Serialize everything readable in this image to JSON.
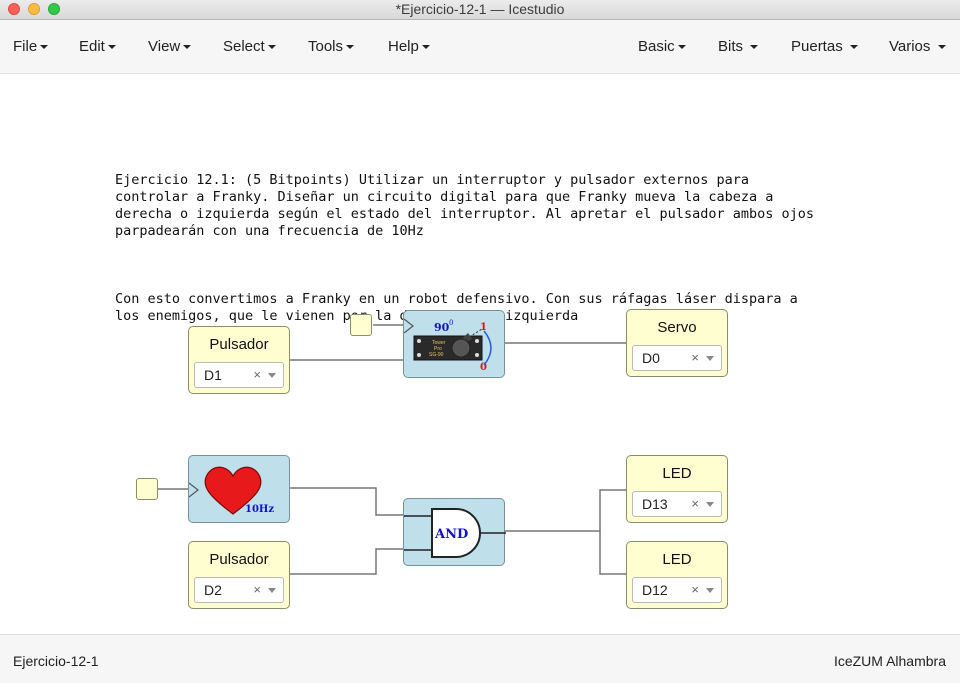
{
  "window": {
    "title": "*Ejercicio-12-1 — Icestudio"
  },
  "menu": {
    "left": [
      "File",
      "Edit",
      "View",
      "Select",
      "Tools",
      "Help"
    ],
    "right": [
      "Basic",
      "Bits",
      "Puertas",
      "Varios"
    ]
  },
  "comment": {
    "paragraph1": "Ejercicio 12.1: (5 Bitpoints) Utilizar un interruptor y pulsador externos para\ncontrolar a Franky. Diseñar un circuito digital para que Franky mueva la cabeza a\nderecha o izquierda según el estado del interruptor. Al apretar el pulsador ambos ojos\nparpadearán con una frecuencia de 10Hz",
    "paragraph2": "Con esto convertimos a Franky en un robot defensivo. Con sus ráfagas láser dispara a\nlos enemigos, que le vienen por la derecha y la izquierda"
  },
  "blocks": {
    "pulsador1": {
      "title": "Pulsador",
      "pin": "D1"
    },
    "pulsador2": {
      "title": "Pulsador",
      "pin": "D2"
    },
    "servo": {
      "title": "Servo",
      "pin": "D0"
    },
    "led1": {
      "title": "LED",
      "pin": "D13"
    },
    "led2": {
      "title": "LED",
      "pin": "D12"
    },
    "servo_module": {
      "angle": "90",
      "degree": "0",
      "one": "1",
      "zero": "0",
      "label1": "Tower",
      "label2": "Pro",
      "label3": "SG-90"
    },
    "heart": {
      "freq": "10Hz"
    },
    "and_gate": {
      "label": "AND"
    },
    "clear_glyph": "×"
  },
  "colors": {
    "io_block": "#fffed0",
    "blue_block": "#bfdfea",
    "heart": "#e8191b",
    "gate_text": "#1111cc"
  },
  "status": {
    "left": "Ejercicio-12-1",
    "right": "IceZUM Alhambra"
  }
}
